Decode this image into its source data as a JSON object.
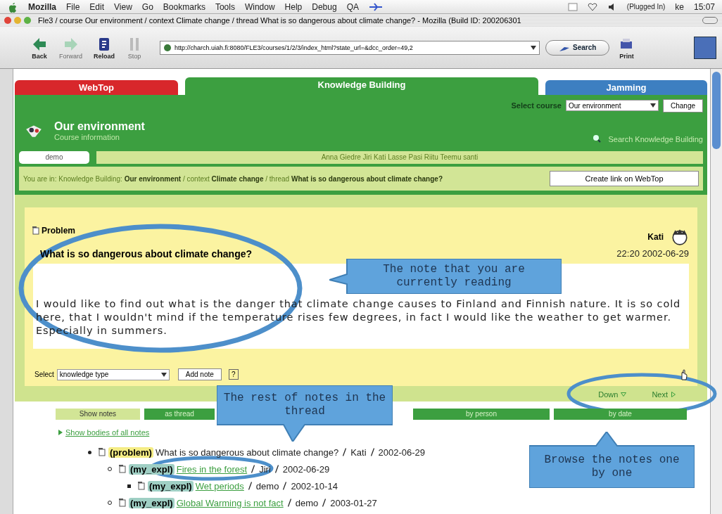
{
  "menubar": {
    "app": "Mozilla",
    "menus": [
      "File",
      "Edit",
      "View",
      "Go",
      "Bookmarks",
      "Tools",
      "Window",
      "Help",
      "Debug",
      "QA"
    ],
    "battery": "(Plugged In)",
    "user": "ke",
    "clock": "15:07"
  },
  "window": {
    "title": "Fle3 / course Our environment / context Climate change / thread What is so dangerous about climate change? - Mozilla (Build ID: 200206301"
  },
  "toolbar": {
    "buttons": [
      {
        "label": "Back",
        "kind": "back",
        "disabled": false
      },
      {
        "label": "Forward",
        "kind": "forward",
        "disabled": true
      },
      {
        "label": "Reload",
        "kind": "reload",
        "disabled": false
      },
      {
        "label": "Stop",
        "kind": "stop",
        "disabled": true
      }
    ],
    "url": "http://charch.uiah.fi:8080/FLE3/courses/1/2/3/index_html?state_url=&dcc_order=49,2",
    "search": "Search",
    "print": "Print"
  },
  "tabs": [
    {
      "label": "WebTop",
      "color": "#d8272b",
      "selected": false
    },
    {
      "label": "Knowledge Building",
      "color": "#3c9f40",
      "selected": true
    },
    {
      "label": "Jamming",
      "color": "#3d7fc1",
      "selected": false
    }
  ],
  "course": {
    "select_label": "Select course",
    "selected_course": "Our environment",
    "change": "Change",
    "title": "Our environment",
    "info": "Course information",
    "search": "Search Knowledge Building"
  },
  "users": {
    "current": "demo",
    "others": "Anna Giedre Jiri Kati Lasse Pasi Riitu Teemu santi"
  },
  "breadcrumb": "You are in: Knowledge Building: **Our environment** / context **Climate change** / thread **What is so dangerous about climate change?**",
  "create_link": "Create link on WebTop",
  "note": {
    "type": "Problem",
    "author": "Kati",
    "title": "What is so dangerous about climate change?",
    "time": "22:20 2002-06-29",
    "body": "I would like to find out what is the danger that climate change causes to Finland and Finnish nature. It is so cold here, that I wouldn't mind if the temperature rises few degrees, in fact I would like the weather to get warmer. Especially in summers."
  },
  "note_actions": {
    "select_label": "Select",
    "select_value": "knowledge type",
    "add": "Add note",
    "help": "?",
    "down": "Down",
    "next": "Next"
  },
  "view": {
    "label": "Show notes",
    "tabs": [
      {
        "label": "as thread"
      },
      {
        "label": "by person"
      },
      {
        "label": "by date"
      }
    ]
  },
  "show_bodies": "Show bodies of all notes",
  "tree": [
    {
      "type": "(problem)",
      "title": "What is so dangerous about climate change?",
      "current": true,
      "author": "Kati",
      "date": "2002-06-29",
      "children": [
        {
          "type": "(my_expl)",
          "title": "Fires in the forest",
          "current": false,
          "author": "Jiri",
          "date": "2002-06-29",
          "children": [
            {
              "type": "(my_expl)",
              "title": "Wet periods",
              "current": false,
              "author": "demo",
              "date": "2002-10-14"
            }
          ]
        },
        {
          "type": "(my_expl)",
          "title": "Global Warming is not fact",
          "current": false,
          "author": "demo",
          "date": "2003-01-27"
        }
      ]
    }
  ],
  "callouts": [
    {
      "text": "The note that you are currently reading",
      "kind": "left"
    },
    {
      "text": "The rest of notes in the thread",
      "kind": "down"
    },
    {
      "text": "Browse the notes one by one",
      "kind": "up"
    }
  ]
}
